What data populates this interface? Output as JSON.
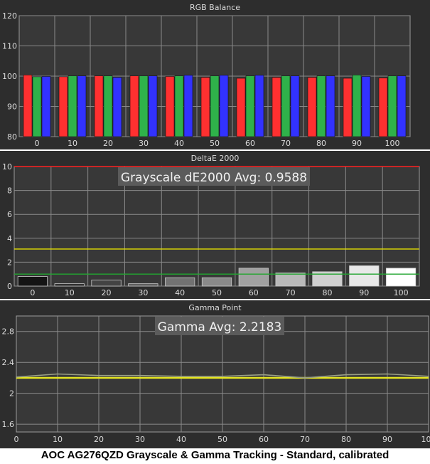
{
  "caption": "AOC AG276QZD Grayscale & Gamma Tracking - Standard, calibrated",
  "colors": {
    "panel_bg": "#2d2d2d",
    "plot_bg": "#383838",
    "grid": "#8a8a8a",
    "text": "#dcdcdc",
    "red": "#ff3030",
    "green": "#2fb24a",
    "blue": "#3232ff",
    "limit_red": "#ff2020",
    "limit_yellow": "#e4e000",
    "limit_green": "#22a630",
    "gamma_line": "#e8e820",
    "gamma_ref": "#9aa086"
  },
  "chart_data": [
    {
      "type": "bar",
      "title": "RGB Balance",
      "categories": [
        "0",
        "10",
        "20",
        "30",
        "40",
        "50",
        "60",
        "70",
        "80",
        "90",
        "100"
      ],
      "ylim": [
        80,
        120
      ],
      "yticks": [
        80,
        90,
        100,
        110,
        120
      ],
      "series": [
        {
          "values": [
            100.4,
            99.8,
            100.1,
            100.1,
            99.9,
            99.6,
            99.3,
            99.6,
            99.6,
            99.3,
            99.4
          ]
        },
        {
          "values": [
            99.8,
            100.1,
            100.1,
            100.1,
            100.1,
            100.1,
            100.1,
            100.1,
            100.1,
            100.4,
            100.1
          ]
        },
        {
          "values": [
            99.9,
            100.1,
            99.6,
            100.1,
            100.3,
            100.3,
            100.3,
            100.1,
            100.1,
            99.9,
            100.1
          ]
        }
      ]
    },
    {
      "type": "bar",
      "title": "DeltaE 2000",
      "annotation": "Grayscale dE2000 Avg: 0.9588",
      "categories": [
        "0",
        "10",
        "20",
        "30",
        "40",
        "50",
        "60",
        "70",
        "80",
        "90",
        "100"
      ],
      "ylim": [
        0,
        10
      ],
      "yticks": [
        0,
        2,
        4,
        6,
        8,
        10
      ],
      "values": [
        0.8,
        0.2,
        0.5,
        0.2,
        0.7,
        0.7,
        1.5,
        1.1,
        1.2,
        1.7,
        1.5
      ],
      "thresholds": [
        10,
        3.1,
        1.0
      ]
    },
    {
      "type": "line",
      "title": "Gamma Point",
      "annotation": "Gamma Avg: 2.2183",
      "x": [
        0,
        10,
        20,
        30,
        40,
        50,
        60,
        70,
        80,
        90,
        100
      ],
      "y": [
        2.21,
        2.25,
        2.23,
        2.23,
        2.22,
        2.22,
        2.24,
        2.2,
        2.24,
        2.25,
        2.22
      ],
      "reference": 2.2,
      "xlim": [
        0,
        100
      ],
      "ylim": [
        1.5,
        3.0
      ],
      "yticks": [
        1.6,
        2.0,
        2.4,
        2.8
      ],
      "xticks": [
        0,
        10,
        20,
        30,
        40,
        50,
        60,
        70,
        80,
        90,
        100
      ]
    }
  ]
}
